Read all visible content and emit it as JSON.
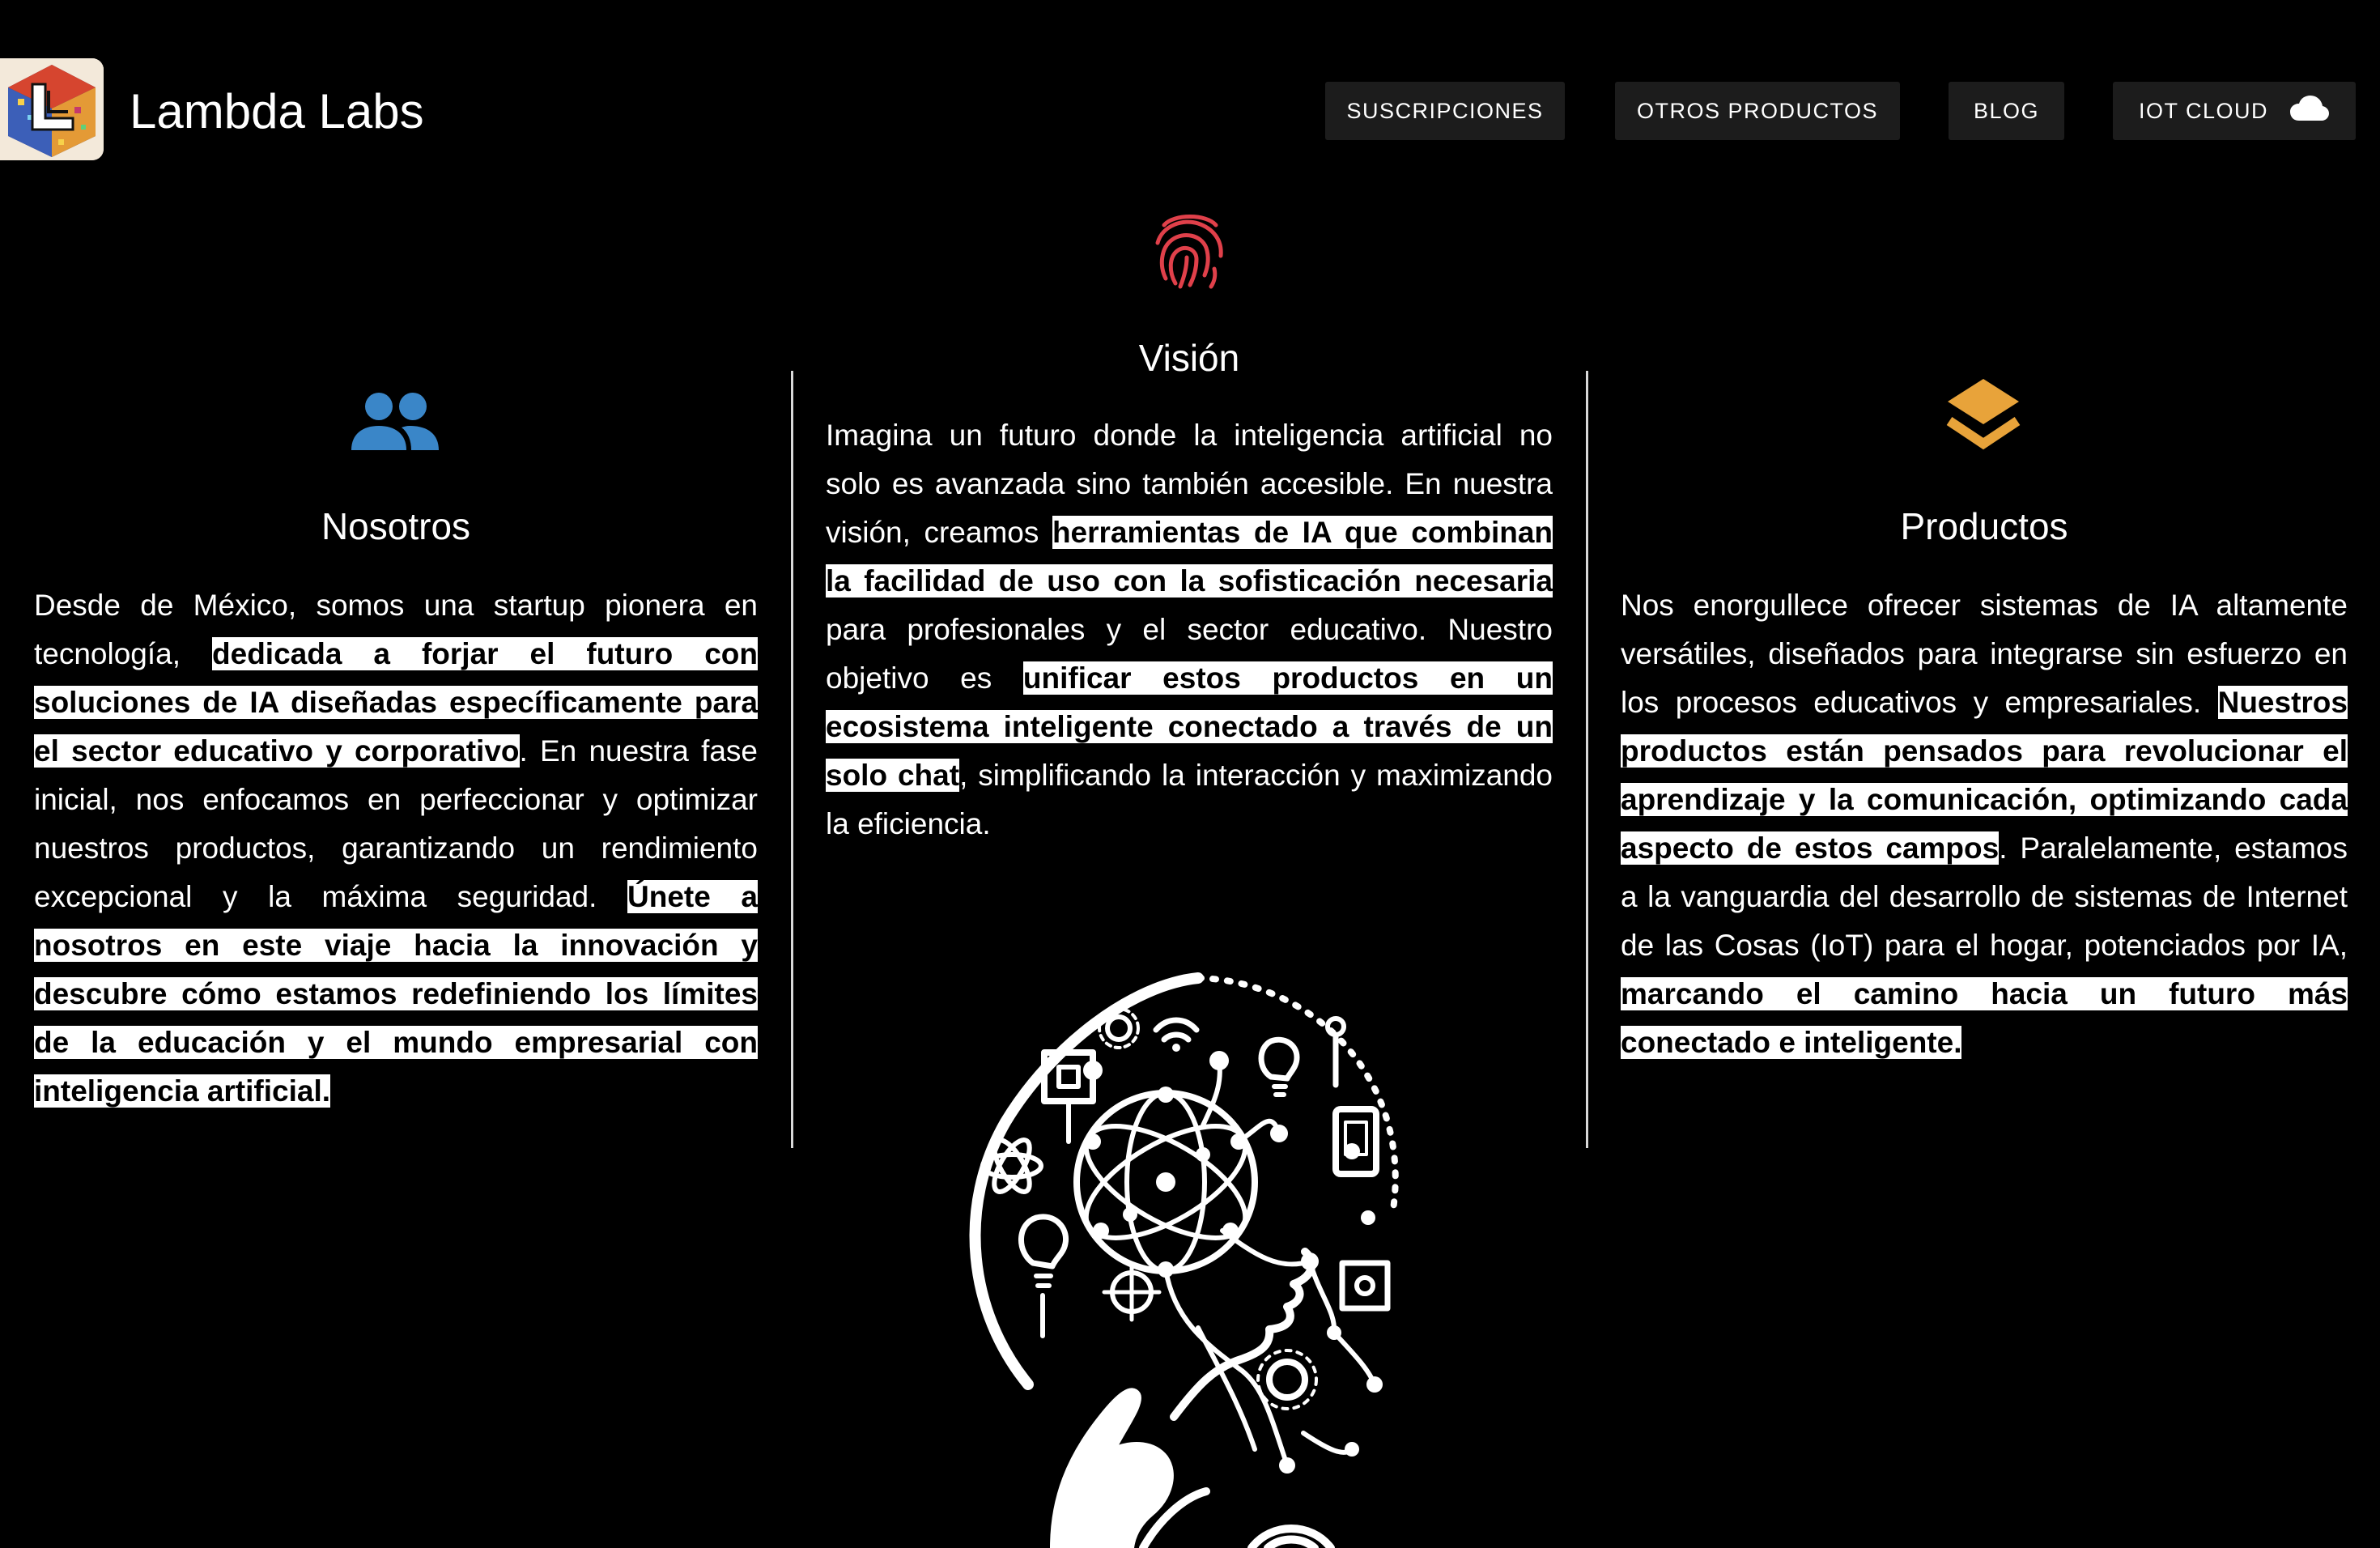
{
  "header": {
    "brand": "Lambda Labs",
    "nav": [
      {
        "label": "SUSCRIPCIONES"
      },
      {
        "label": "OTROS PRODUCTOS"
      },
      {
        "label": "BLOG"
      },
      {
        "label": "IOT CLOUD",
        "icon": "cloud-icon"
      }
    ]
  },
  "nosotros": {
    "icon": "users-icon",
    "icon_color": "#3a86c8",
    "title": "Nosotros",
    "p1": "Desde de México, somos una startup pionera en tecnología, ",
    "h1": "dedicada a forjar el futuro con soluciones de IA diseñadas específicamente para el sector educativo y corporativo",
    "p2": ". En nuestra fase inicial, nos enfocamos en perfeccionar y optimizar nuestros productos, garantizando un rendimiento excepcional y la máxima seguridad. ",
    "h2": "Únete a nosotros en este viaje hacia la innovación y descubre cómo estamos redefiniendo los límites de la educación y el mundo empresarial con inteligencia artificial."
  },
  "vision": {
    "icon": "fingerprint-icon",
    "icon_color": "#e0404a",
    "title": "Visión",
    "p1": "Imagina un futuro donde la inteligencia artificial no solo es avanzada sino también accesible. En nuestra visión, creamos ",
    "h1": "herramientas de IA que combinan la facilidad de uso con la sofisticación necesaria",
    "p2": " para profesionales y el sector educativo. Nuestro objetivo es ",
    "h2": "unificar estos productos en un ecosistema inteligente conectado a través de un solo chat",
    "p3": ", simplificando la interacción y maximizando la eficiencia."
  },
  "productos": {
    "icon": "layers-icon",
    "icon_color": "#e8a33a",
    "title": "Productos",
    "p1": "Nos enorgullece ofrecer sistemas de IA altamente versátiles, diseñados para integrarse sin esfuerzo en los procesos educativos y empresariales. ",
    "h1": "Nuestros productos están pensados para revolucionar el aprendizaje y la comunicación, optimizando cada aspecto de estos campos",
    "p2": ". Paralelamente, estamos a la vanguardia del desarrollo de sistemas de Internet de las Cosas (IoT) para el hogar, potenciados por IA, ",
    "h2": "marcando el camino hacia un futuro más conectado e inteligente."
  }
}
